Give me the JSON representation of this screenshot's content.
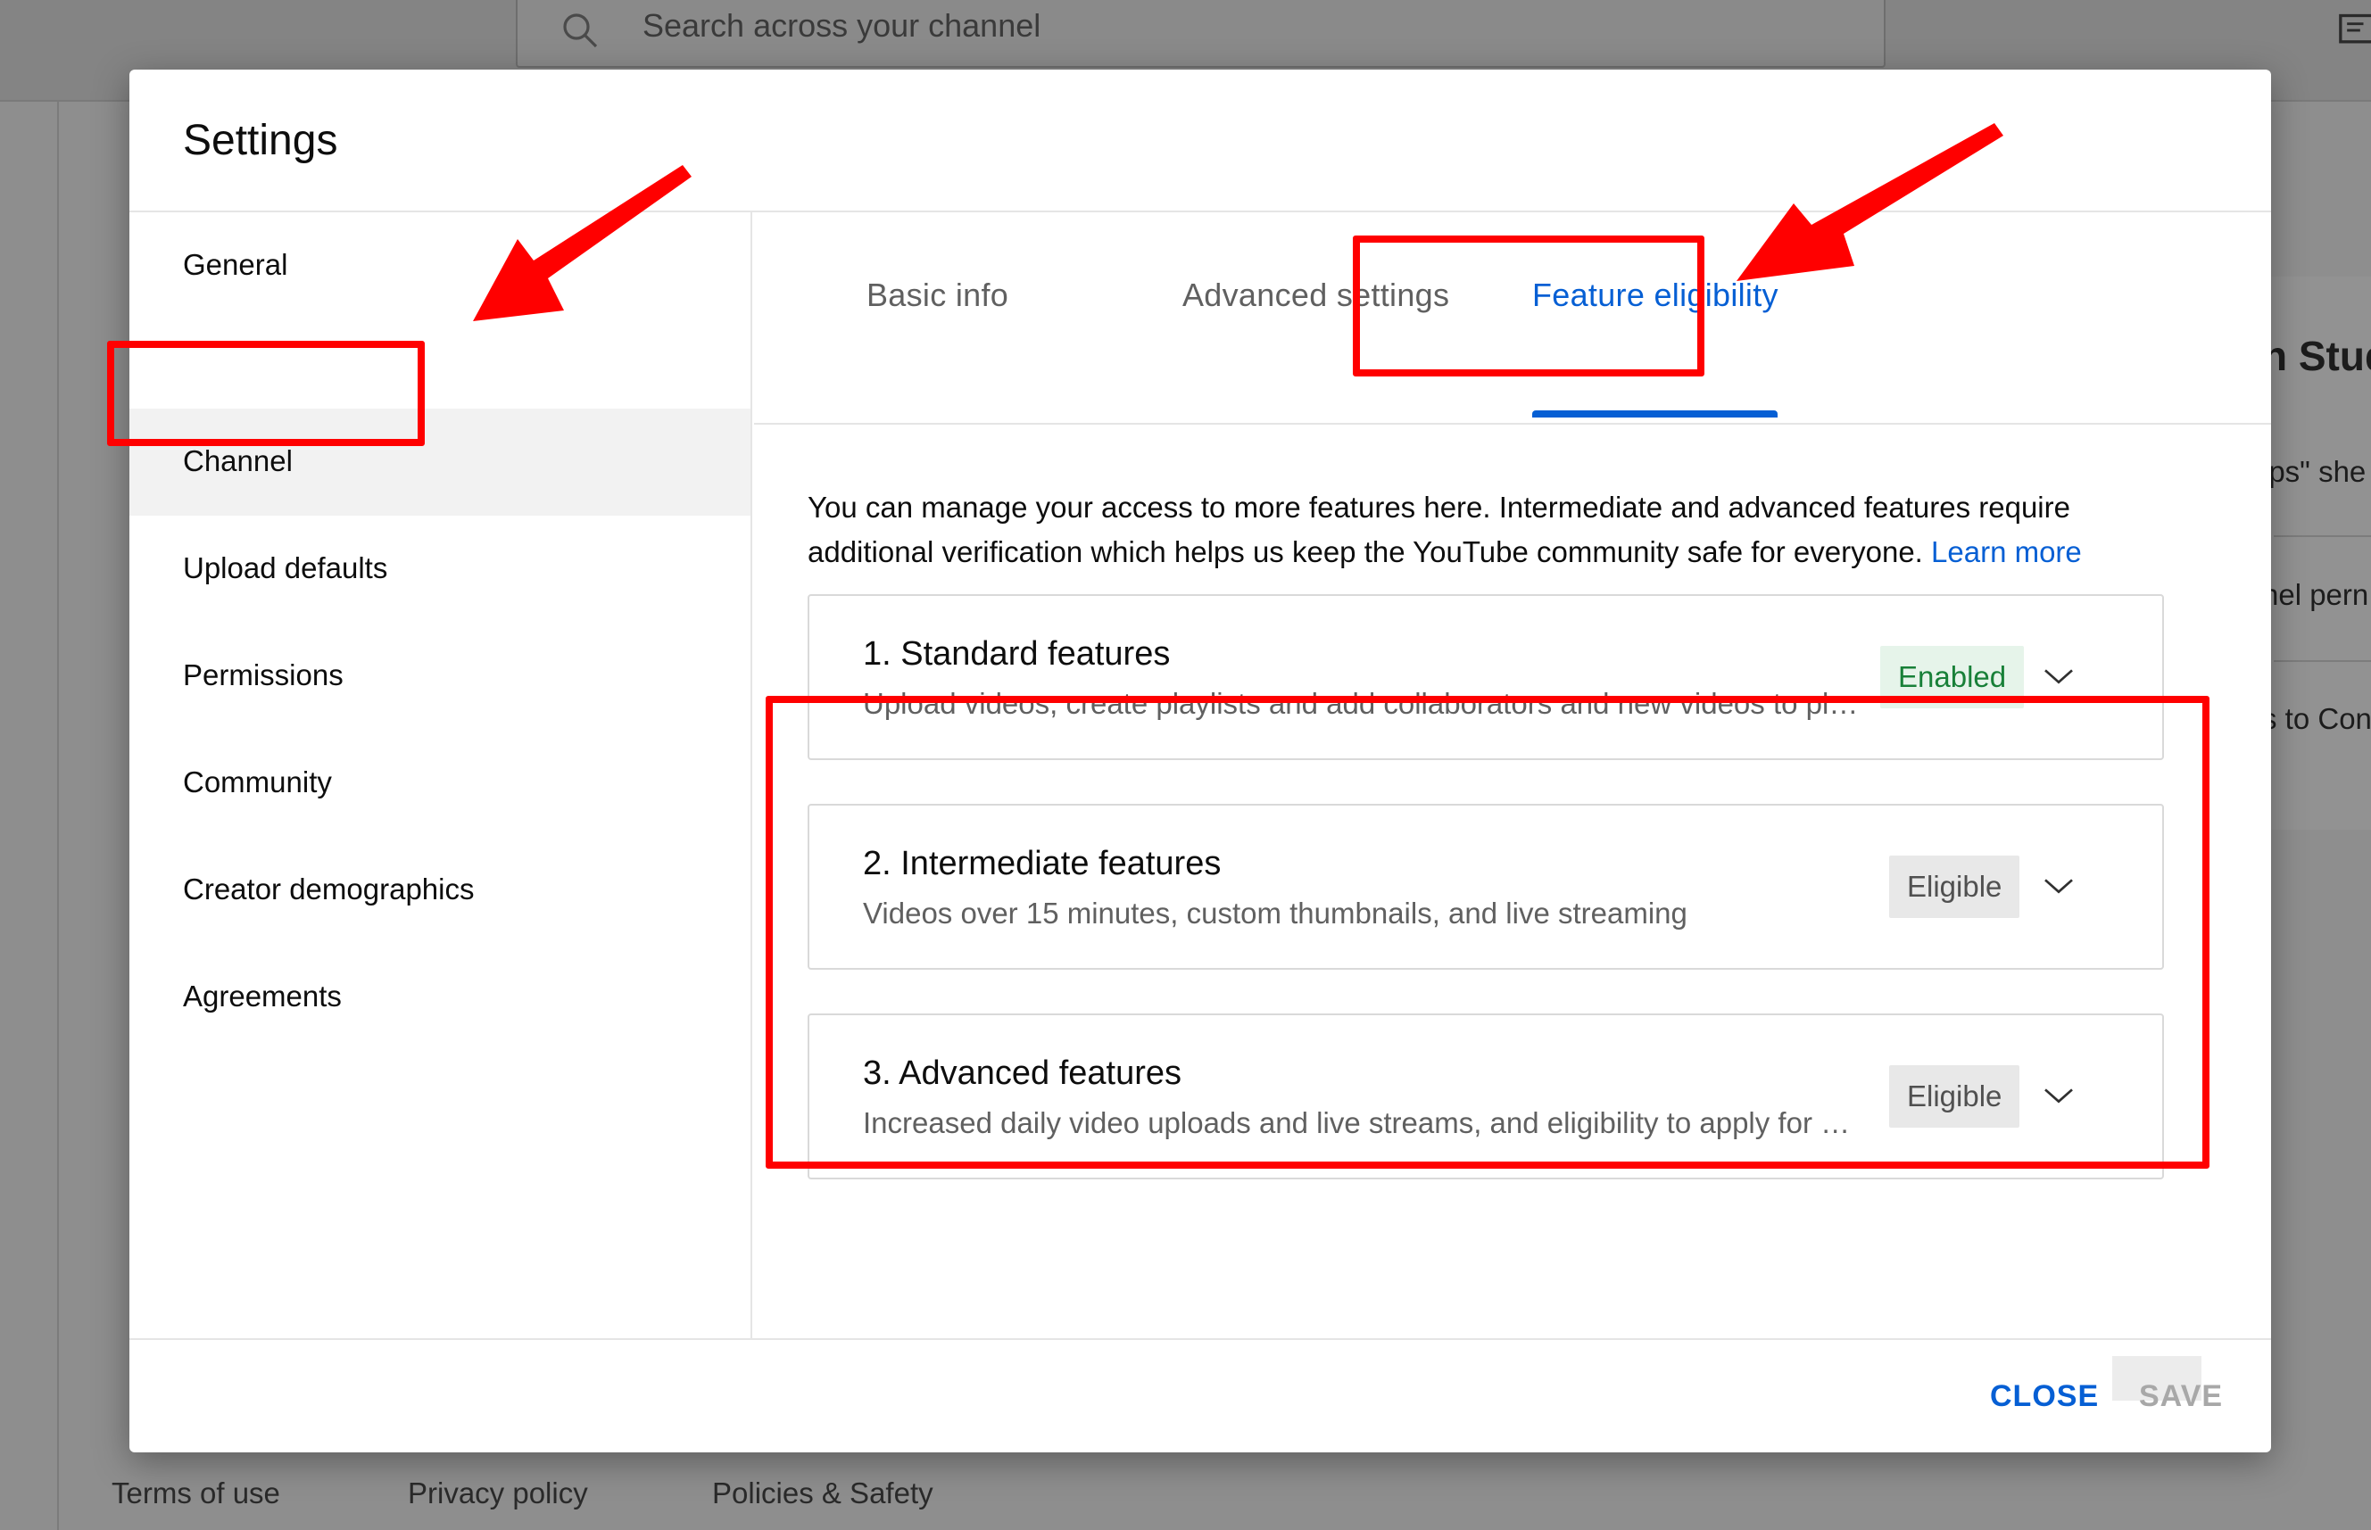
{
  "background": {
    "search_placeholder": "Search across your channel",
    "card": {
      "title_fragment": "n Stud",
      "line1": "ips\" she",
      "line2": "nel pern",
      "line3": "s to Con"
    },
    "footer_links": [
      "Terms of use",
      "Privacy policy",
      "Policies & Safety"
    ]
  },
  "dialog": {
    "title": "Settings",
    "nav": [
      {
        "label": "General",
        "active": false
      },
      {
        "label": "Channel",
        "active": true
      },
      {
        "label": "Upload defaults",
        "active": false
      },
      {
        "label": "Permissions",
        "active": false
      },
      {
        "label": "Community",
        "active": false
      },
      {
        "label": "Creator demographics",
        "active": false
      },
      {
        "label": "Agreements",
        "active": false
      }
    ],
    "tabs": [
      {
        "label": "Basic info",
        "active": false
      },
      {
        "label": "Advanced settings",
        "active": false
      },
      {
        "label": "Feature eligibility",
        "active": true
      }
    ],
    "intro_text": "You can manage your access to more features here. Intermediate and advanced features require additional verification which helps us keep the YouTube community safe for everyone.",
    "learn_more": "Learn more",
    "features": [
      {
        "title": "1. Standard features",
        "description": "Upload videos, create playlists and add collaborators and new videos to play…",
        "status": "Enabled"
      },
      {
        "title": "2. Intermediate features",
        "description": "Videos over 15 minutes, custom thumbnails, and live streaming",
        "status": "Eligible"
      },
      {
        "title": "3. Advanced features",
        "description": "Increased daily video uploads and live streams, and eligibility to apply for mo…",
        "status": "Eligible"
      }
    ],
    "footer": {
      "close_label": "CLOSE",
      "save_label": "SAVE"
    }
  },
  "colors": {
    "accent": "#065fd4",
    "enabled_bg": "#e6f4ea",
    "enabled_text": "#188038",
    "annotation": "#ff0000"
  }
}
